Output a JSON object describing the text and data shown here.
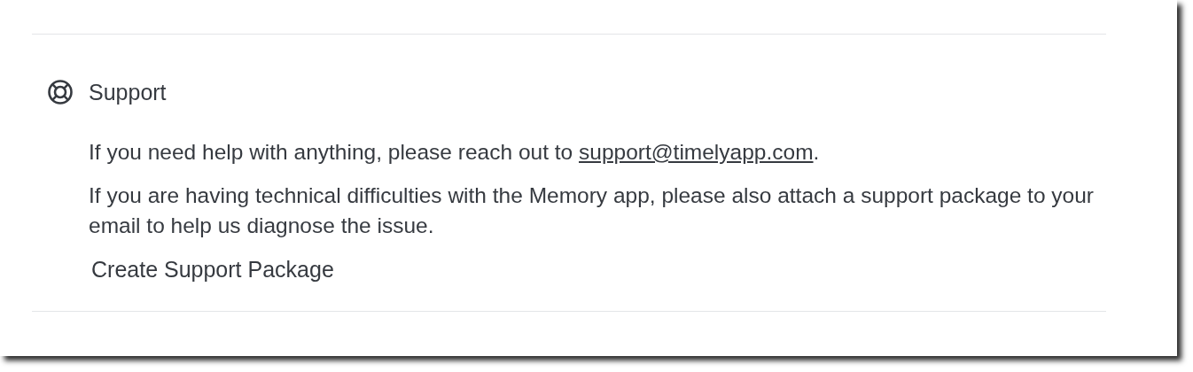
{
  "section": {
    "title": "Support",
    "paragraphs": [
      {
        "text": "If you need help with anything, please reach out to ",
        "link": "support@timelyapp.com",
        "after": "."
      },
      {
        "text": "If you are having technical difficulties with the Memory app, please also attach a support package to your email to help us diagnose the issue."
      }
    ],
    "button": "Create Support Package"
  }
}
